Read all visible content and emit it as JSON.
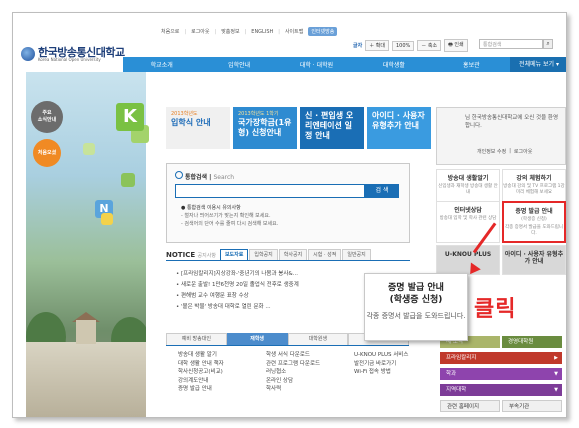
{
  "header": {
    "top_links": [
      "처음으로",
      "로그아웃",
      "맞춤정보",
      "ENGLISH",
      "사이트맵",
      "인터넷방송"
    ],
    "logo_text": "한국방송통신대학교",
    "logo_sub": "Korea National Open University",
    "tools": {
      "font_label": "글자",
      "shrink": "축소",
      "zoom": "확대",
      "zoom_level": "100%",
      "print": "인쇄"
    },
    "search_placeholder": "통합검색"
  },
  "nav": {
    "items": [
      "학교소개",
      "입학안내",
      "대학 · 대학원",
      "대학생활",
      "홍보관"
    ],
    "all_menu": "전체메뉴 보기"
  },
  "left": {
    "btn_main": [
      "주요",
      "소식안내"
    ],
    "btn_first": "처음오셨"
  },
  "banners": [
    {
      "sub": "2013학년도",
      "title": "입학식 안내"
    },
    {
      "sub": "2013학년도 1학기",
      "title": "국가장학금(1유형) 신청안내"
    },
    {
      "sub": "",
      "title": "신 · 편입생 오리엔테이션 일정 안내"
    },
    {
      "sub": "",
      "title": "아이디 · 사용자 유형추가 안내"
    }
  ],
  "search": {
    "title": "통합검색",
    "title_en": "Search",
    "button": "검 색",
    "tips": [
      "통합검색 이용시 유의사항",
      "- 철자나 띄어쓰기가 맞는지 확인해 보세요.",
      "- 검색어의 단어 수를 줄여 다시 검색해 보세요."
    ]
  },
  "notice": {
    "title": "NOTICE",
    "title_sub": "공지사항",
    "tabs": [
      "보도자료",
      "입학공지",
      "학사공지",
      "시험 · 성적",
      "일반공지"
    ],
    "items": [
      "[프라임칼리지]지상강좌-'중년기의 나봄과 봉사&...",
      "새로운 출발! 1만6천명 20일 졸업식 전후로 생중계",
      "편해범 교수 여행문 표창 수상",
      "'볼은 박물' 방송대 대학로 열린 문화 ..."
    ]
  },
  "bottom_tabs": {
    "tabs": [
      "예비 방송대인",
      "재학생",
      "대학원생",
      "교직원"
    ],
    "col1": [
      "방송대 생활 알기",
      "대학 생활 안내 책자",
      "학사신청공고(비교)",
      "강의계도안내",
      "증명 발급 안내"
    ],
    "col2": [
      "학생 서식 다운로드",
      "관련 프로그램 다운로드",
      "러닝협소",
      "온라인 상담",
      "학사력"
    ],
    "col3": [
      "U-KNOU PLUS 서비스",
      "발전기금 바로가기",
      "Wi-Fi 접속 방법"
    ]
  },
  "login": {
    "message": "님 한국방송통신대학교에 오신 것을 환영합니다.",
    "links": [
      "개인정보 수정",
      "로그아웃"
    ]
  },
  "quick": [
    {
      "title": "방송대 생활알기",
      "desc": "신입생과 재학생 방송대 생활 안내"
    },
    {
      "title": "강의 체험하기",
      "desc": "방송대 강의 및 TV 프로그램 1강 미리 체험해 보세요"
    },
    {
      "title": "인터넷상담",
      "desc": "방송대 입학 및 학사 관련 상담"
    },
    {
      "title": "증명 발급 안내",
      "sub": "(학생증 신청)",
      "desc": "각종 증명서 발급을 도와드립니다."
    },
    {
      "title": "U-KNOU PLUS",
      "desc": ""
    },
    {
      "title": "아이디 · 사용자 유형추가 안내",
      "desc": ""
    }
  ],
  "right_bottom": {
    "daily": "새 소식",
    "alumni": "경영대학원",
    "prime": "프라임칼리지",
    "dept": "학과",
    "region": "지역대학",
    "related": "관련 홈페이지",
    "affiliated": "부속기관"
  },
  "popup": {
    "title": "증명 발급 안내",
    "subtitle": "(학생증 신청)",
    "desc": "각종 증명서 발급을 도와드립니다."
  },
  "annotation": {
    "label": "클릭",
    "color": "#e52828"
  },
  "colors": {
    "nav": "#2a8fd6",
    "accent": "#1a6eb5",
    "highlight": "#e52828"
  }
}
